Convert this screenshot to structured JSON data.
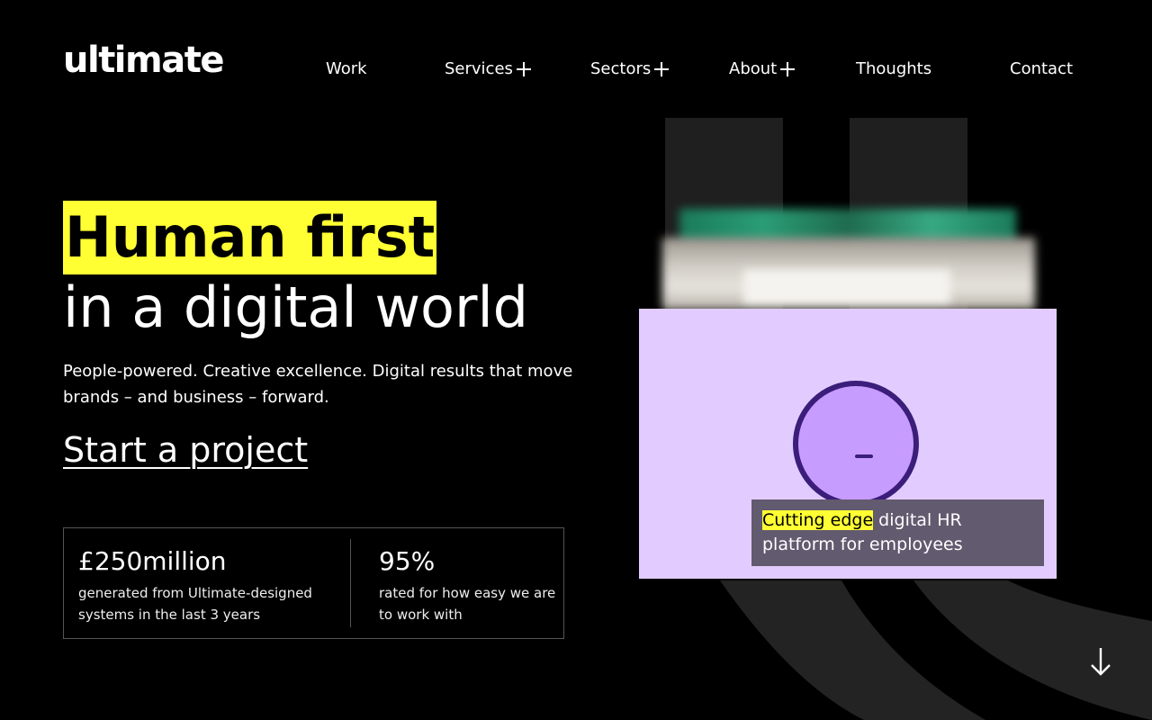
{
  "brand": {
    "logo_text": "ultimate",
    "highlight_color": "#ffff33",
    "card_color": "#e2ccff"
  },
  "nav": {
    "items": [
      {
        "label": "Work",
        "has_submenu": false
      },
      {
        "label": "Services",
        "has_submenu": true
      },
      {
        "label": "Sectors",
        "has_submenu": true
      },
      {
        "label": "About",
        "has_submenu": true
      },
      {
        "label": "Thoughts",
        "has_submenu": false
      },
      {
        "label": "Contact",
        "has_submenu": false
      }
    ]
  },
  "hero": {
    "title_highlight": "Human first",
    "title_rest": "in a digital world",
    "subtitle": "People-powered. Creative excellence. Digital results that move brands – and business – forward.",
    "cta_label": "Start a project"
  },
  "stats": [
    {
      "value": "£250million",
      "label": "generated from Ultimate-designed systems in the last 3 years"
    },
    {
      "value": "95%",
      "label": "rated for how easy we are to work with"
    }
  ],
  "feature_card": {
    "caption_highlight": "Cutting edge",
    "caption_rest": " digital HR platform for employees"
  },
  "icons": {
    "scroll": "arrow-down-icon",
    "submenu": "plus-icon"
  }
}
